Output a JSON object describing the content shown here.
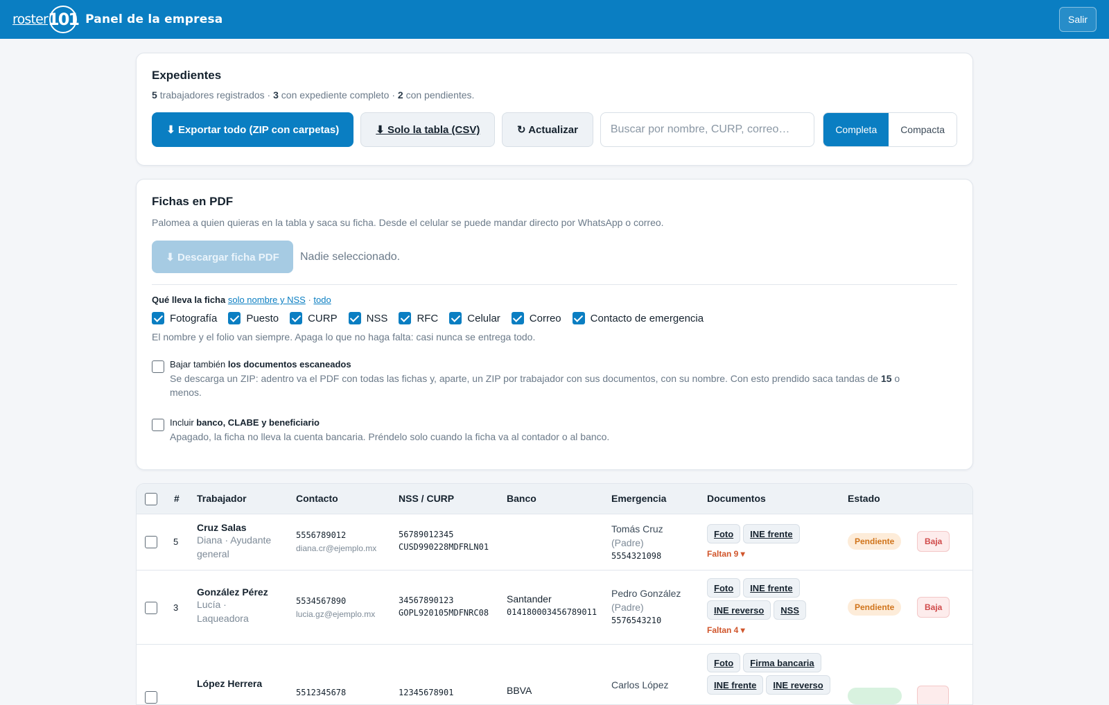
{
  "header": {
    "logo_text": "roster",
    "logo_mark": "101",
    "title": "Panel de la empresa",
    "logout": "Salir"
  },
  "expedientes": {
    "title": "Expedientes",
    "summary": {
      "registered_count": "5",
      "registered_text": "trabajadores registrados · ",
      "complete_count": "3",
      "complete_text": "con expediente completo · ",
      "pending_count": "2",
      "pending_text": "con pendientes."
    },
    "export_all": "⬇ Exportar todo (ZIP con carpetas)",
    "export_csv": "⬇ Solo la tabla (CSV)",
    "refresh": "↻ Actualizar",
    "search_placeholder": "Buscar por nombre, CURP, correo…",
    "view_full": "Completa",
    "view_compact": "Compacta"
  },
  "fichas": {
    "title": "Fichas en PDF",
    "description": "Palomea a quien quieras en la tabla y saca su ficha. Desde el celular se puede mandar directo por WhatsApp o correo.",
    "download": "⬇ Descargar ficha PDF",
    "selection_status": "Nadie seleccionado.",
    "fields_label": "Qué lleva la ficha",
    "link_minimal": "solo nombre y NSS",
    "link_sep": " · ",
    "link_all": "todo",
    "fields": [
      {
        "label": "Fotografía",
        "checked": true
      },
      {
        "label": "Puesto",
        "checked": true
      },
      {
        "label": "CURP",
        "checked": true
      },
      {
        "label": "NSS",
        "checked": true
      },
      {
        "label": "RFC",
        "checked": true
      },
      {
        "label": "Celular",
        "checked": true
      },
      {
        "label": "Correo",
        "checked": true
      },
      {
        "label": "Contacto de emergencia",
        "checked": true
      }
    ],
    "fields_hint": "El nombre y el folio van siempre. Apaga lo que no haga falta: casi nunca se entrega todo.",
    "docs_option": {
      "prefix": "Bajar también ",
      "bold": "los documentos escaneados",
      "desc_before": "Se descarga un ZIP: adentro va el PDF con todas las fichas y, aparte, un ZIP por trabajador con sus documentos, con su nombre. Con esto prendido saca tandas de ",
      "desc_number": "15",
      "desc_after": " o menos.",
      "checked": false
    },
    "bank_option": {
      "prefix": "Incluir ",
      "bold": "banco, CLABE y beneficiario",
      "desc": "Apagado, la ficha no lleva la cuenta bancaria. Préndelo solo cuando la ficha va al contador o al banco.",
      "checked": false
    }
  },
  "table": {
    "columns": {
      "num": "#",
      "worker": "Trabajador",
      "contact": "Contacto",
      "ids": "NSS / CURP",
      "bank": "Banco",
      "emergency": "Emergencia",
      "documents": "Documentos",
      "status": "Estado"
    },
    "rows": [
      {
        "num": "5",
        "surname": "Cruz Salas",
        "given_role": "Diana · Ayudante general",
        "phone": "5556789012",
        "email": "diana.cr@ejemplo.mx",
        "nss": "56789012345",
        "curp": "CUSD990228MDFRLN01",
        "bank": "",
        "clabe": "",
        "emergency_name": "Tomás Cruz",
        "emergency_relation": "(Padre)",
        "emergency_phone": "5554321098",
        "documents": [
          "Foto",
          "INE frente"
        ],
        "missing": "Faltan 9 ▾",
        "status": "Pendiente",
        "action": "Baja"
      },
      {
        "num": "3",
        "surname": "González Pérez",
        "given_role": "Lucía · Laqueadora",
        "phone": "5534567890",
        "email": "lucia.gz@ejemplo.mx",
        "nss": "34567890123",
        "curp": "GOPL920105MDFNRC08",
        "bank": "Santander",
        "clabe": "014180003456789011",
        "emergency_name": "Pedro González",
        "emergency_relation": "(Padre)",
        "emergency_phone": "5576543210",
        "documents": [
          "Foto",
          "INE frente",
          "INE reverso",
          "NSS"
        ],
        "missing": "Faltan 4 ▾",
        "status": "Pendiente",
        "action": "Baja"
      },
      {
        "num": "",
        "surname": "López Herrera",
        "given_role": "",
        "phone": "5512345678",
        "email": "",
        "nss": "12345678901",
        "curp": "",
        "bank": "BBVA",
        "clabe": "",
        "emergency_name": "Carlos López",
        "emergency_relation": "",
        "emergency_phone": "",
        "documents": [
          "Foto",
          "Firma bancaria",
          "INE frente",
          "INE reverso"
        ],
        "missing": "",
        "status": "",
        "action": ""
      }
    ]
  },
  "colors": {
    "brand": "#0a7ec2",
    "pending_bg": "#fdecd9",
    "pending_fg": "#d0741b",
    "danger": "#d04a4a"
  }
}
